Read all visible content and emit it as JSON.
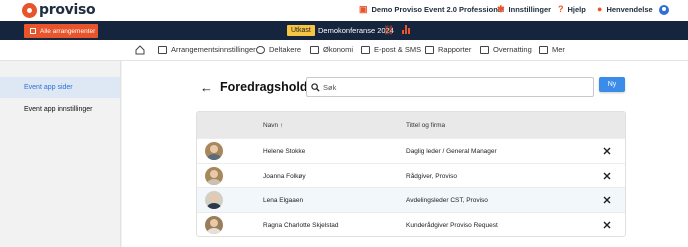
{
  "brand": {
    "name": "proviso"
  },
  "topbar": {
    "product": "Demo Proviso Event 2.0 Professional",
    "settings": "Innstillinger",
    "help": "Hjelp",
    "inquiry": "Henvendelse"
  },
  "eventbar": {
    "all_events": "Alle arrangementer",
    "status": "Utkast",
    "event_name": "Demokonferanse 2024"
  },
  "nav": {
    "items": [
      {
        "label": "Arrangementsinnstillinger",
        "icon": "settings-list-icon"
      },
      {
        "label": "Deltakere",
        "icon": "people-icon"
      },
      {
        "label": "Økonomi",
        "icon": "money-icon"
      },
      {
        "label": "E-post & SMS",
        "icon": "mail-icon"
      },
      {
        "label": "Rapporter",
        "icon": "report-icon"
      },
      {
        "label": "Overnatting",
        "icon": "bed-icon"
      },
      {
        "label": "Mer",
        "icon": "grid-icon"
      }
    ]
  },
  "sidebar": {
    "items": [
      {
        "label": "Event app sider",
        "active": true
      },
      {
        "label": "Event app innstillinger",
        "active": false
      }
    ]
  },
  "main": {
    "title": "Foredragsholdere",
    "search_placeholder": "Søk",
    "new_label": "Ny"
  },
  "table": {
    "col_name": "Navn",
    "col_title": "Tittel og firma",
    "rows": [
      {
        "name": "Helene Stokke",
        "title": "Daglig leder / General Manager"
      },
      {
        "name": "Joanna Folkøy",
        "title": "Rådgiver, Proviso"
      },
      {
        "name": "Lena Elgaaen",
        "title": "Avdelingsleder CST, Proviso"
      },
      {
        "name": "Ragna Charlotte Skjelstad",
        "title": "Kunderådgiver Proviso Request"
      }
    ]
  },
  "colors": {
    "accent": "#e8542b",
    "navy": "#14253d",
    "primary": "#3b8be8",
    "badge": "#f6c544"
  }
}
